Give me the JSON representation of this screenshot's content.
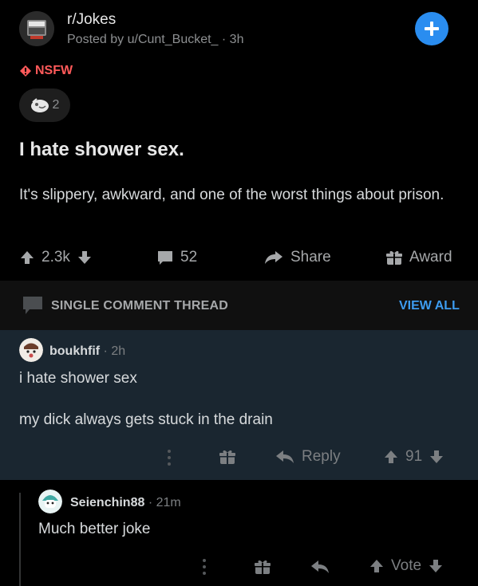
{
  "post": {
    "subreddit": "r/Jokes",
    "posted_by": "Posted by u/Cunt_Bucket_ · 3h",
    "nsfw_label": "NSFW",
    "award_count": "2",
    "title": "I hate shower sex.",
    "body": "It's slippery, awkward, and one of the worst things about prison.",
    "upvotes": "2.3k",
    "comments": "52",
    "share_label": "Share",
    "award_label": "Award"
  },
  "thread": {
    "label": "SINGLE COMMENT THREAD",
    "view_all": "VIEW ALL"
  },
  "comments": [
    {
      "user": "boukhfif",
      "age": "· 2h",
      "line1": "i hate shower sex",
      "line2": "my dick always gets stuck in the drain",
      "reply_label": "Reply",
      "votes": "91"
    },
    {
      "user": "Seienchin88",
      "age": "· 21m",
      "text": "Much better joke",
      "vote_label": "Vote"
    }
  ],
  "colors": {
    "accent": "#2a8df0",
    "nsfw": "#ff5a5a",
    "link": "#3d9cf0",
    "highlight_bg": "#1a2630"
  }
}
